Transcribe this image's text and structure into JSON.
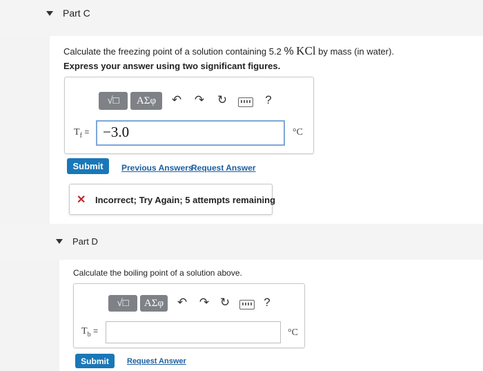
{
  "partC": {
    "title": "Part C",
    "question_pre": "Calculate the freezing point of a solution containing 5.2 ",
    "question_pct": "%",
    "question_formula": "KCl",
    "question_post": " by mass (in water).",
    "instruction": "Express your answer using two significant figures.",
    "toolbar": {
      "templates_label": "√□",
      "symbols_label": "ΑΣφ",
      "undo": "↶",
      "redo": "↷",
      "reset": "↻",
      "help": "?"
    },
    "variable": "T",
    "variable_sub": "f",
    "equals": "=",
    "answer_value": "−3.0",
    "unit": "°C",
    "submit_label": "Submit",
    "previous_answers_label": "Previous Answers",
    "request_answer_label": "Request Answer",
    "feedback_icon": "✕",
    "feedback_text": "Incorrect; Try Again; 5 attempts remaining"
  },
  "partD": {
    "title": "Part D",
    "question": "Calculate the boiling point of a solution above.",
    "toolbar": {
      "templates_label": "√□",
      "symbols_label": "ΑΣφ",
      "undo": "↶",
      "redo": "↷",
      "reset": "↻",
      "help": "?"
    },
    "variable": "T",
    "variable_sub": "b",
    "equals": "=",
    "answer_value": "",
    "unit": "°C",
    "submit_label": "Submit",
    "request_answer_label": "Request Answer"
  },
  "colors": {
    "submit": "#1a77b7",
    "link": "#1d5fa0",
    "incorrect": "#c6262e",
    "toolbar_button": "#7e8287",
    "active_input_border": "#7da7d9"
  }
}
